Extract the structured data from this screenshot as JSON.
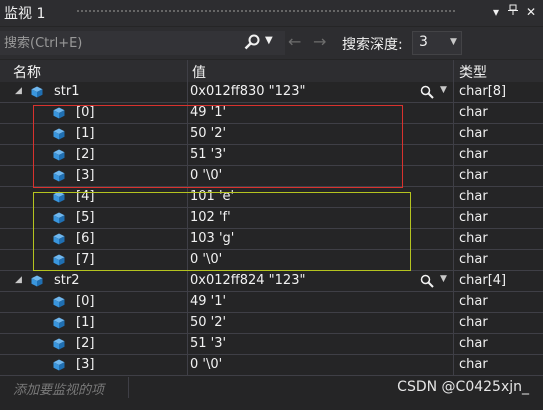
{
  "window": {
    "title": "监视 1"
  },
  "search": {
    "placeholder": "搜索(Ctrl+E)",
    "depth_label": "搜索深度:",
    "depth_value": "3"
  },
  "columns": {
    "name": "名称",
    "value": "值",
    "type": "类型"
  },
  "rows": [
    {
      "name": "str1",
      "value": "0x012ff830 \"123\"",
      "type": "char[8]"
    },
    {
      "name": "[0]",
      "value": "49 '1'",
      "type": "char"
    },
    {
      "name": "[1]",
      "value": "50 '2'",
      "type": "char"
    },
    {
      "name": "[2]",
      "value": "51 '3'",
      "type": "char"
    },
    {
      "name": "[3]",
      "value": "0 '\\0'",
      "type": "char"
    },
    {
      "name": "[4]",
      "value": "101 'e'",
      "type": "char"
    },
    {
      "name": "[5]",
      "value": "102 'f'",
      "type": "char"
    },
    {
      "name": "[6]",
      "value": "103 'g'",
      "type": "char"
    },
    {
      "name": "[7]",
      "value": "0 '\\0'",
      "type": "char"
    },
    {
      "name": "str2",
      "value": "0x012ff824 \"123\"",
      "type": "char[4]"
    },
    {
      "name": "[0]",
      "value": "49 '1'",
      "type": "char"
    },
    {
      "name": "[1]",
      "value": "50 '2'",
      "type": "char"
    },
    {
      "name": "[2]",
      "value": "51 '3'",
      "type": "char"
    },
    {
      "name": "[3]",
      "value": "0 '\\0'",
      "type": "char"
    }
  ],
  "add_watch_placeholder": "添加要监视的项",
  "watermark": "CSDN @C0425xjn_",
  "colors": {
    "background": "#252526",
    "highlight_red": "#d9322e",
    "highlight_yellow": "#b5c41f",
    "cube_icon": "#3a96dd"
  }
}
